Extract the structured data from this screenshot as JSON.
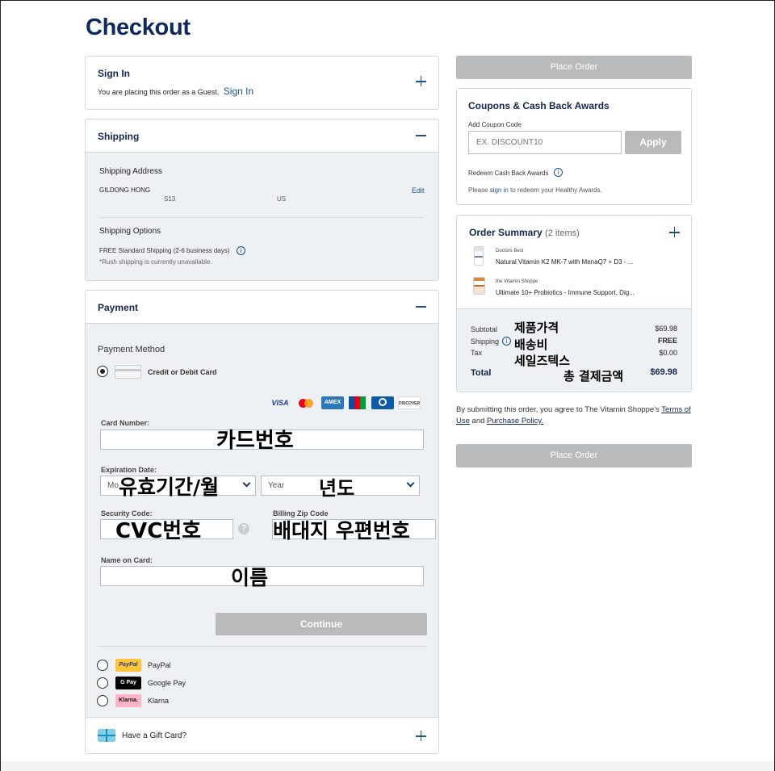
{
  "page": {
    "title": "Checkout"
  },
  "signin": {
    "title": "Sign In",
    "guest_text": "You are placing this order as a Guest.",
    "link": "Sign In"
  },
  "shipping": {
    "title": "Shipping",
    "address_label": "Shipping Address",
    "name": "GILDONG HONG",
    "line1": "S13",
    "country": "US",
    "edit": "Edit",
    "options_label": "Shipping Options",
    "option_text": "FREE  Standard Shipping (2-6 business days)",
    "rush_note": "*Rush shipping is currently unavailable."
  },
  "payment": {
    "title": "Payment",
    "method_label": "Payment Method",
    "card_option": "Credit or Debit Card",
    "card_brands": [
      "VISA",
      "MC",
      "AMEX",
      "JCB",
      "DC",
      "DISCOVER"
    ],
    "card_number_label": "Card Number:",
    "card_number_overlay": "카드번호",
    "expiration_label": "Expiration Date:",
    "month_value": "Mo",
    "expiration_overlay": "유효기간/월",
    "year_value": "Year",
    "year_overlay": "년도",
    "security_label": "Security Code:",
    "security_overlay": "CVC번호",
    "help_icon": "?",
    "zip_label": "Billing Zip Code",
    "zip_overlay": "배대지 우편번호",
    "name_label": "Name on Card:",
    "name_overlay": "이름",
    "continue": "Continue",
    "alt_methods": [
      {
        "logo": "PayPal",
        "label": "PayPal"
      },
      {
        "logo": "G Pay",
        "label": "Google Pay"
      },
      {
        "logo": "Klarna.",
        "label": "Klarna"
      }
    ]
  },
  "gift": {
    "title": "Have a Gift Card?"
  },
  "sidebar": {
    "place_order": "Place Order",
    "coupons_title": "Coupons & Cash Back Awards",
    "add_coupon_label": "Add Coupon Code",
    "coupon_placeholder": "EX. DISCOUNT10",
    "apply": "Apply",
    "redeem_label": "Redeem Cash Back Awards",
    "redeem_pre": "Please",
    "redeem_link": "sign in",
    "redeem_post": "to redeem your Healthy Awards.",
    "summary_title": "Order Summary",
    "summary_count": "(2 items)",
    "items": [
      {
        "brand": "Doctors Best",
        "name": "Natural Vitamin K2 MK-7 with MenaQ7 + D3 - ..."
      },
      {
        "brand": "the Vitamin Shoppe",
        "name": "Ultimate 10+ Probiotics - Immune Support, Dig..."
      }
    ],
    "subtotal_label": "Subtotal",
    "subtotal_value": "$69.98",
    "subtotal_overlay": "제품가격",
    "shipping_label": "Shipping",
    "shipping_value": "FREE",
    "shipping_overlay": "배송비",
    "tax_label": "Tax",
    "tax_value": "$0.00",
    "tax_overlay": "세일즈텍스",
    "total_label": "Total",
    "total_value": "$69.98",
    "total_overlay": "총 결제금액",
    "agree_text": "By submitting this order, you agree to The Vitamin Shoppe's",
    "terms_link": "Terms of Use",
    "and_text": "and",
    "purchase_link": "Purchase Policy."
  },
  "colors": {
    "navy": "#0e2a5a",
    "accent": "#1d4f8a",
    "disabled": "#b9babb",
    "panel": "#eef1f4"
  }
}
